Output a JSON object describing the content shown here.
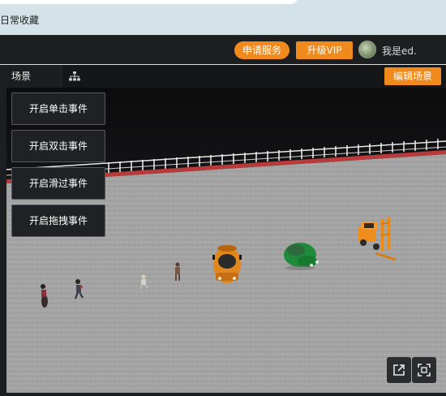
{
  "browser": {
    "bookmark_label": "日常收藏"
  },
  "header": {
    "service_button": "申请服务",
    "vip_button": "升级VIP",
    "username": "我是ed."
  },
  "tabs": {
    "scene_tab": "场景",
    "edit_button": "编辑场景"
  },
  "events": [
    {
      "label": "开启单击事件"
    },
    {
      "label": "开启双击事件"
    },
    {
      "label": "开启滑过事件"
    },
    {
      "label": "开启拖拽事件"
    }
  ],
  "icons": {
    "tree": "hierarchy-icon",
    "share": "external-link-icon",
    "fullscreen": "fullscreen-icon",
    "avatar": "user-avatar"
  },
  "colors": {
    "accent": "#f08a1c",
    "header_bg": "#1d1e20",
    "ground": "#a6a6a6"
  }
}
